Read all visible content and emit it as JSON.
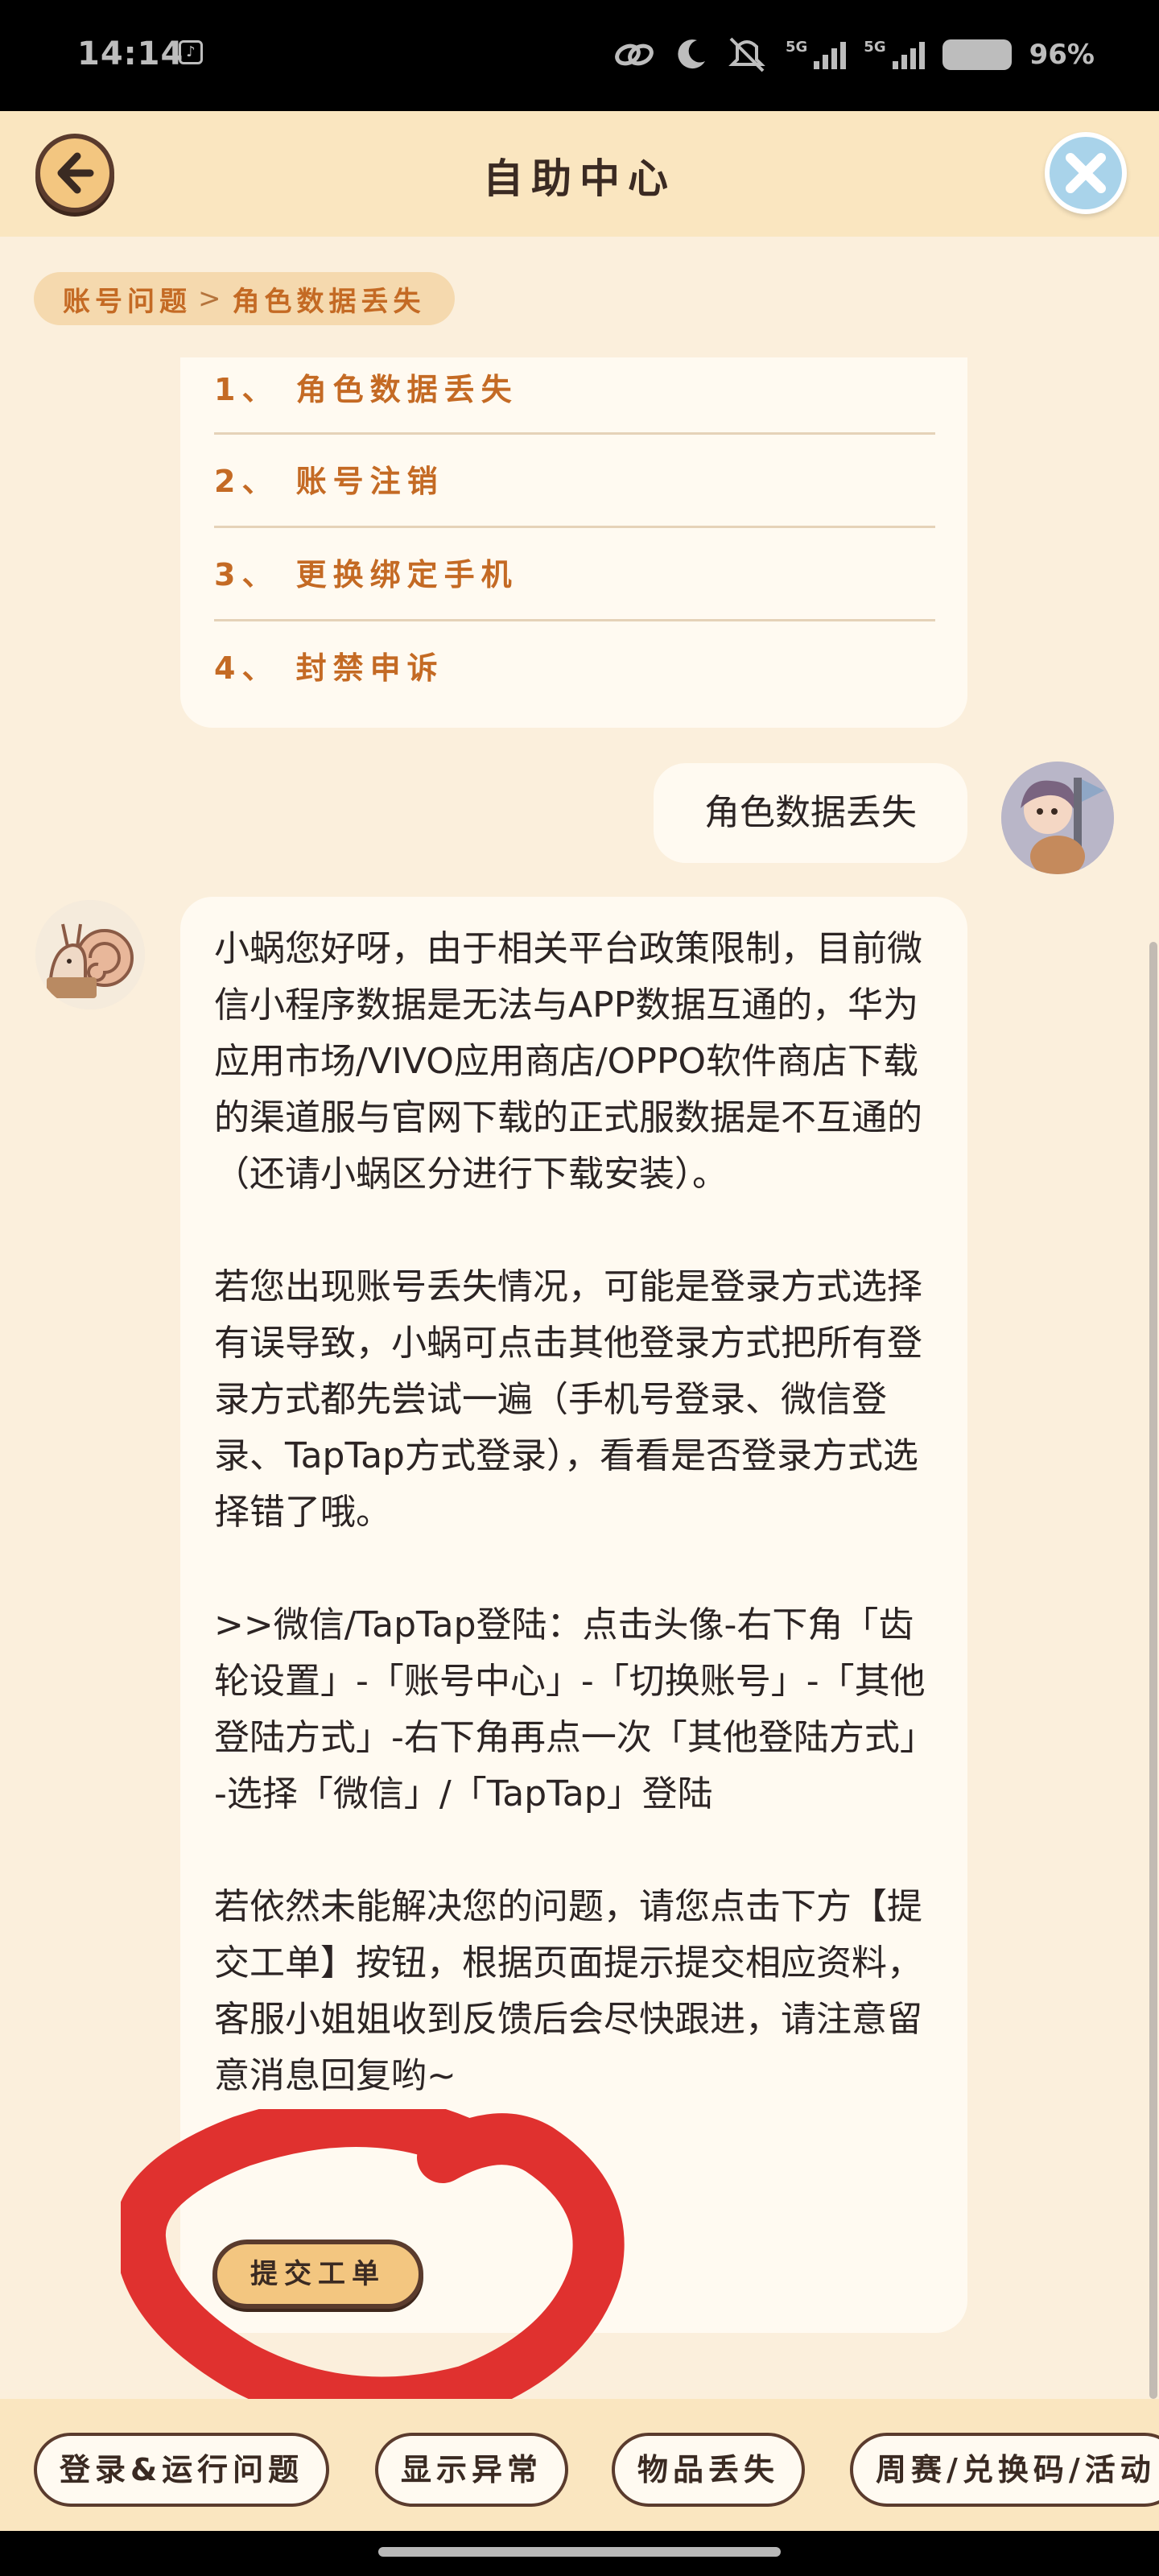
{
  "status_bar": {
    "time": "14:14",
    "network_1": "5G",
    "network_2": "5G",
    "battery": "96%",
    "icons": [
      "tiktok-icon",
      "link-icon",
      "moon-icon",
      "mute-icon",
      "signal-icon",
      "signal-icon",
      "battery-icon"
    ]
  },
  "header": {
    "title": "自助中心",
    "back_icon": "back-arrow-icon",
    "close_icon": "close-icon"
  },
  "breadcrumb": {
    "parent": "账号问题",
    "separator": ">",
    "current": "角色数据丢失"
  },
  "topics": [
    {
      "label": "1、 角色数据丢失"
    },
    {
      "label": "2、 账号注销"
    },
    {
      "label": "3、 更换绑定手机"
    },
    {
      "label": "4、 封禁申诉"
    }
  ],
  "user_message": "角色数据丢失",
  "bot_message": {
    "paragraphs": [
      "小蜗您好呀，由于相关平台政策限制，目前微信小程序数据是无法与APP数据互通的，华为应用市场/VIVO应用商店/OPPO软件商店下载的渠道服与官网下载的正式服数据是不互通的（还请小蜗区分进行下载安装）。",
      "若您出现账号丢失情况，可能是登录方式选择有误导致，小蜗可点击其他登录方式把所有登录方式都先尝试一遍（手机号登录、微信登录、TapTap方式登录），看看是否登录方式选择错了哦。",
      ">>微信/TapTap登陆：点击头像-右下角「齿轮设置」-「账号中心」-「切换账号」-「其他登陆方式」-右下角再点一次「其他登陆方式」-选择「微信」/「TapTap」登陆",
      "若依然未能解决您的问题，请您点击下方【提交工单】按钮，根据页面提示提交相应资料，客服小姐姐收到反馈后会尽快跟进，请注意留意消息回复哟~"
    ],
    "button_label": "提交工单"
  },
  "quick_chips": [
    {
      "label": "登录&运行问题"
    },
    {
      "label": "显示异常"
    },
    {
      "label": "物品丢失"
    },
    {
      "label": "周赛/兑换码/活动"
    }
  ],
  "colors": {
    "background": "#fbefdc",
    "header": "#fae6c0",
    "accent_orange": "#c46a24",
    "button_fill": "#f3c680",
    "button_border": "#5a3b2d",
    "annotation_red": "#e0312f"
  }
}
